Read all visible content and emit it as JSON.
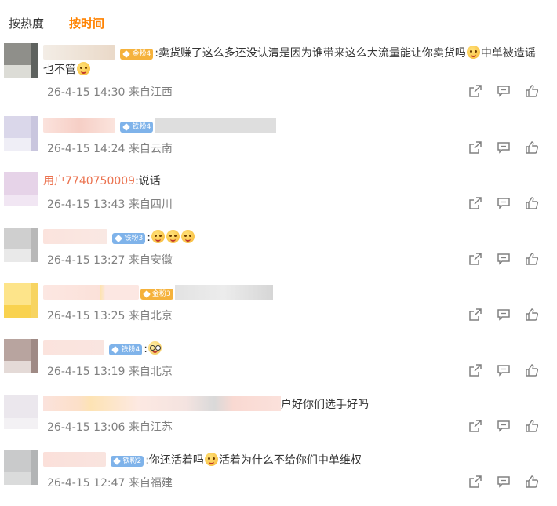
{
  "tabs": [
    {
      "label": "按热度",
      "active": false
    },
    {
      "label": "按时间",
      "active": true
    }
  ],
  "accent_color": "#ff8200",
  "username_color": "#eb7350",
  "comments": [
    {
      "badge": "金粉4",
      "text": ":卖货赚了这么多还没认清是因为谁带来这么大流量能让你卖货吗",
      "text_after_emoji": "中单被造谣也不管",
      "meta": "26-4-15 14:30 来自江西"
    },
    {
      "badge": "铁粉4",
      "text": "",
      "meta": "26-4-15 14:24 来自云南"
    },
    {
      "username": "用户7740750009",
      "text": ":说话",
      "meta": "26-4-15 13:43 来自四川"
    },
    {
      "badge": "铁粉3",
      "text": ":",
      "meta": "26-4-15 13:27 来自安徽"
    },
    {
      "badge": "金粉3",
      "text": "",
      "meta": "26-4-15 13:25 来自北京"
    },
    {
      "badge": "铁粉4",
      "text": ":",
      "meta": "26-4-15 13:19 来自北京"
    },
    {
      "text": "户好你们选手好吗",
      "meta": "26-4-15 13:06 来自江苏"
    },
    {
      "badge": "铁粉2",
      "text": ":你还活着吗",
      "text_after_emoji": "活着为什么不给你们中单维权",
      "meta": "26-4-15 12:47 来自福建"
    }
  ],
  "icons": {
    "share": "share-icon",
    "comment": "comment-icon",
    "like": "thumbs-up-icon"
  }
}
